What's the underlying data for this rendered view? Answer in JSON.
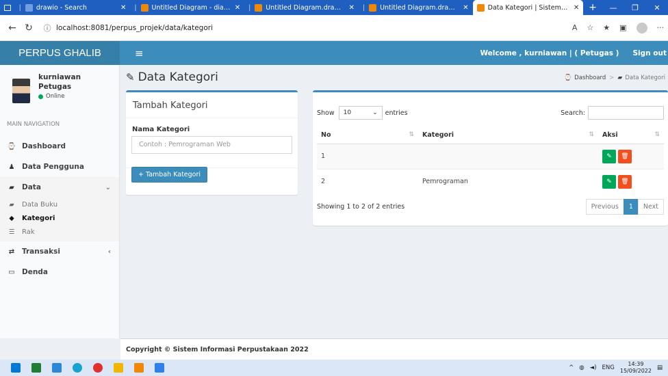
{
  "browser": {
    "tabs": [
      {
        "title": "drawio - Search",
        "icon_color": "#6f9fe0",
        "active": false
      },
      {
        "title": "Untitled Diagram - diagrams.",
        "icon_color": "#f08705",
        "active": false
      },
      {
        "title": "Untitled Diagram.drawio - dr",
        "icon_color": "#f08705",
        "active": false
      },
      {
        "title": "Untitled Diagram.drawio - dr",
        "icon_color": "#f08705",
        "active": false
      },
      {
        "title": "Data Kategori | Sistem Inform",
        "icon_color": "#f08705",
        "active": true
      }
    ],
    "url": "localhost:8081/perpus_projek/data/kategori"
  },
  "app": {
    "logo": "PERPUS GHALIB",
    "welcome": "Welcome ,  kurniawan | ( Petugas )",
    "signout": "Sign out"
  },
  "user": {
    "name": "kurniawan",
    "role": "Petugas",
    "status": "Online"
  },
  "sidebar": {
    "header": "MAIN NAVIGATION",
    "items": [
      {
        "label": "Dashboard",
        "icon": "dashboard-icon"
      },
      {
        "label": "Data Pengguna",
        "icon": "user-icon"
      },
      {
        "label": "Data",
        "icon": "book-icon"
      },
      {
        "label": "Transaksi",
        "icon": "exchange-icon"
      },
      {
        "label": "Denda",
        "icon": "money-icon"
      }
    ],
    "subitems": [
      {
        "label": "Data Buku",
        "icon": "book-icon"
      },
      {
        "label": "Kategori",
        "icon": "tag-icon"
      },
      {
        "label": "Rak",
        "icon": "list-icon"
      }
    ]
  },
  "page": {
    "title": "Data Kategori",
    "breadcrumb": [
      "Dashboard",
      "Data Kategori"
    ]
  },
  "form": {
    "title": "Tambah Kategori",
    "label": "Nama Kategori",
    "placeholder": "Contoh : Pemrograman Web",
    "button": "Tambah Kategori"
  },
  "table": {
    "show_label": "Show",
    "entries_value": "10",
    "entries_label": "entries",
    "search_label": "Search:",
    "columns": [
      "No",
      "Kategori",
      "Aksi"
    ],
    "rows": [
      {
        "no": "1",
        "kategori": ""
      },
      {
        "no": "2",
        "kategori": "Pemrograman"
      }
    ],
    "info": "Showing 1 to 2 of 2 entries",
    "pager": {
      "prev": "Previous",
      "page": "1",
      "next": "Next"
    }
  },
  "footer": "Copyright © Sistem Informasi Perpustakaan 2022",
  "taskbar": {
    "lang": "ENG",
    "time": "14:39",
    "date": "15/09/2022"
  }
}
